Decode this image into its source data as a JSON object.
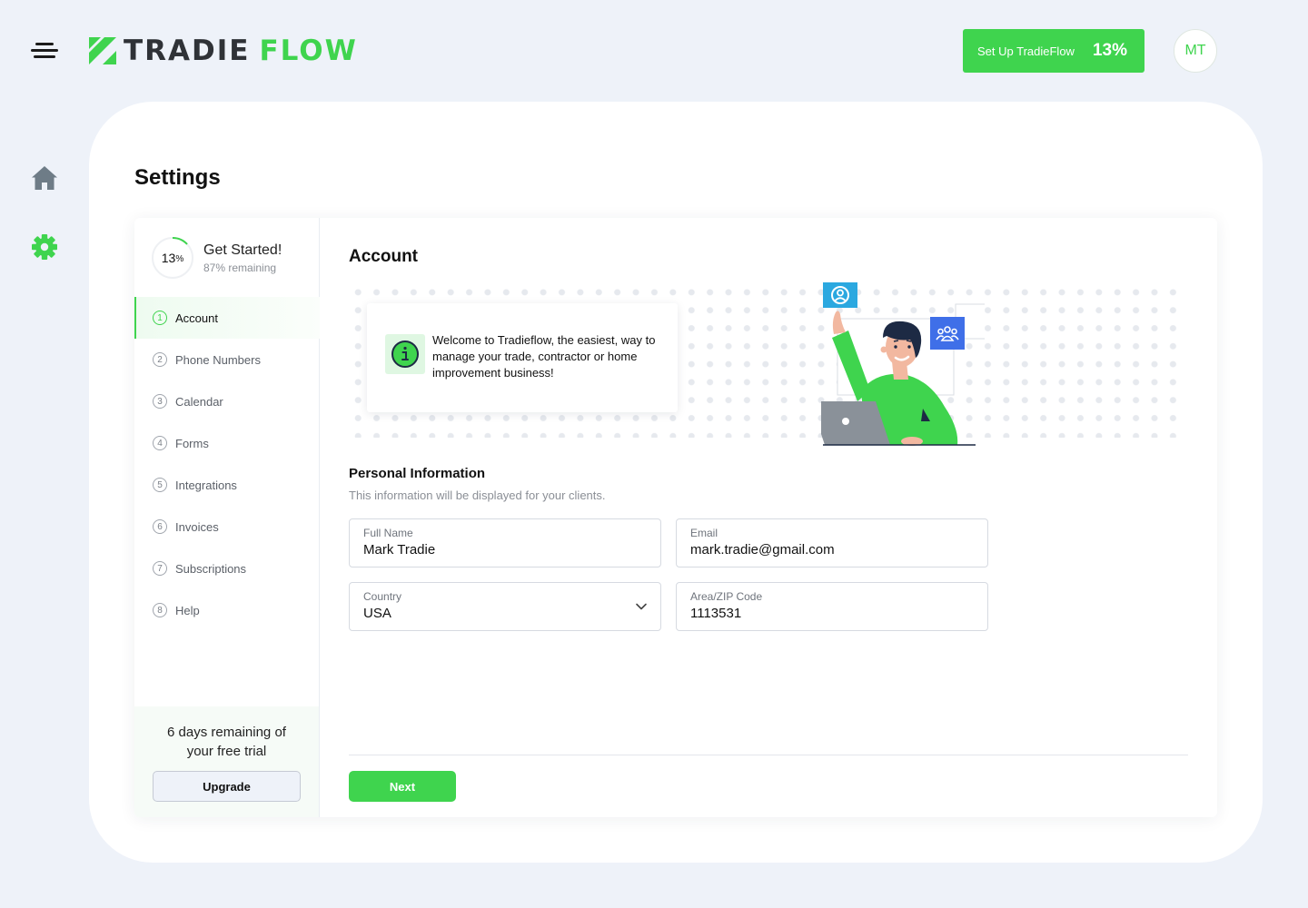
{
  "header": {
    "brand_part1": "TRADIE",
    "brand_part2": "FLOW",
    "setup_label": "Set Up TradieFlow",
    "setup_percent": "13%",
    "avatar_initials": "MT"
  },
  "rail": {
    "items": [
      "home-icon",
      "gear-icon"
    ],
    "active": "gear-icon"
  },
  "page": {
    "title": "Settings"
  },
  "progress": {
    "value_number": "13",
    "value_unit": "%",
    "fraction": 0.13,
    "title": "Get Started!",
    "remaining": "87% remaining"
  },
  "nav": {
    "items": [
      {
        "num": "1",
        "label": "Account",
        "active": true
      },
      {
        "num": "2",
        "label": "Phone Numbers"
      },
      {
        "num": "3",
        "label": "Calendar"
      },
      {
        "num": "4",
        "label": "Forms"
      },
      {
        "num": "5",
        "label": "Integrations"
      },
      {
        "num": "6",
        "label": "Invoices"
      },
      {
        "num": "7",
        "label": "Subscriptions"
      },
      {
        "num": "8",
        "label": "Help"
      }
    ]
  },
  "trial": {
    "line1": "6 days remaining of",
    "line2": "your free trial",
    "upgrade_label": "Upgrade"
  },
  "account": {
    "title": "Account",
    "welcome": "Welcome to Tradieflow, the easiest, way to manage your trade, contractor or home improvement business!",
    "personal_title": "Personal Information",
    "personal_subtitle": "This information will be displayed for your clients.",
    "fields": {
      "full_name": {
        "label": "Full Name",
        "value": "Mark Tradie"
      },
      "email": {
        "label": "Email",
        "value": "mark.tradie@gmail.com"
      },
      "country": {
        "label": "Country",
        "value": "USA"
      },
      "zip": {
        "label": "Area/ZIP Code",
        "value": "1113531"
      }
    },
    "next_label": "Next"
  },
  "colors": {
    "accent": "#3FD44E",
    "background": "#EEF2F9",
    "dark": "#2F3237",
    "blue": "#3F6FE8",
    "sky": "#2BA8E0"
  }
}
